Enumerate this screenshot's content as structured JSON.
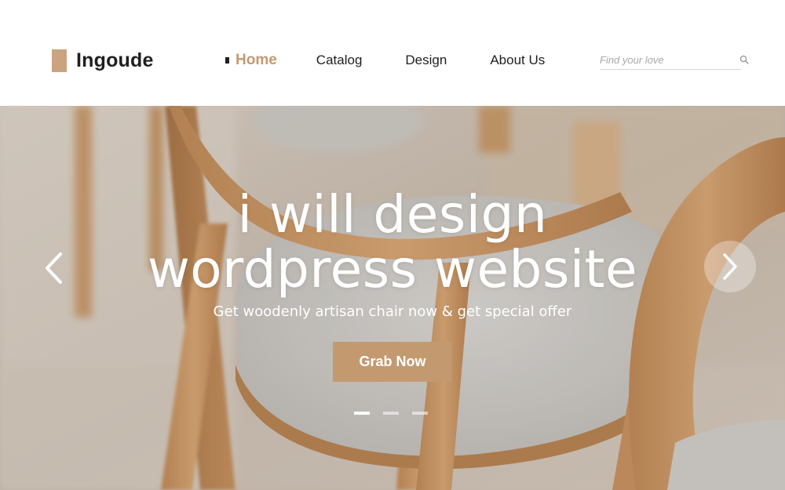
{
  "brand": {
    "name": "Ingoude",
    "accent_color": "#c39a70",
    "logo_mark_color": "#c9a47e"
  },
  "nav": {
    "items": [
      {
        "label": "Home",
        "active": true
      },
      {
        "label": "Catalog",
        "active": false
      },
      {
        "label": "Design",
        "active": false
      },
      {
        "label": "About Us",
        "active": false
      }
    ]
  },
  "search": {
    "placeholder": "Find your love",
    "value": "",
    "icon": "search-icon"
  },
  "hero": {
    "title_line1": "i will design",
    "title_line2": "wordpress website",
    "subtitle": "Get woodenly artisan chair now & get special offer",
    "cta_label": "Grab Now",
    "prev_icon": "chevron-left-icon",
    "next_icon": "chevron-right-icon",
    "slides_count": 3,
    "active_slide": 1
  }
}
